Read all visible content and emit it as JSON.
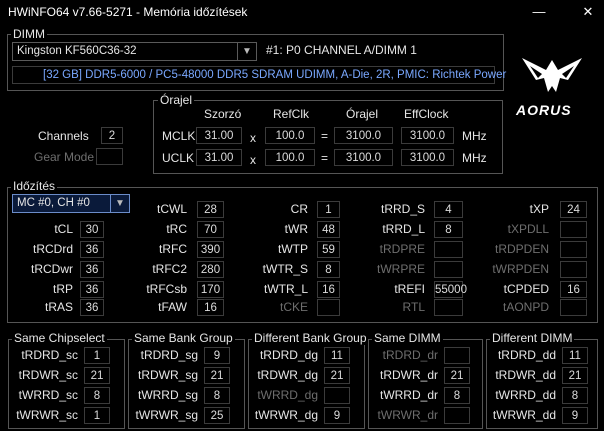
{
  "window": {
    "title": "HWiNFO64 v7.66-5271 - Memória időzítések",
    "minimize": "—",
    "close": "✕"
  },
  "dimm": {
    "group_label": "DIMM",
    "module": "Kingston KF560C36-32",
    "slot": "#1: P0 CHANNEL A/DIMM 1",
    "info": "[32 GB] DDR5-6000 / PC5-48000 DDR5 SDRAM UDIMM, A-Die, 2R, PMIC: Richtek Power"
  },
  "logo": {
    "text": "AORUS"
  },
  "channels": {
    "label": "Channels",
    "value": "2",
    "gear_label": "Gear Mode",
    "gear_value": ""
  },
  "clock": {
    "group_label": "Órajel",
    "headers": [
      "Szorzó",
      "RefClk",
      "Órajel",
      "EffClock"
    ],
    "rows": [
      {
        "label": "MCLK",
        "mult": "31.00",
        "x": "x",
        "ref": "100.0",
        "eq": "=",
        "clock": "3100.0",
        "eff": "3100.0",
        "unit": "MHz"
      },
      {
        "label": "UCLK",
        "mult": "31.00",
        "x": "x",
        "ref": "100.0",
        "eq": "=",
        "clock": "3100.0",
        "eff": "3100.0",
        "unit": "MHz"
      }
    ]
  },
  "timings": {
    "group_label": "Időzítés",
    "selector": "MC #0, CH #0",
    "col1": [
      {
        "label": "tCL",
        "value": "30"
      },
      {
        "label": "tRCDrd",
        "value": "36"
      },
      {
        "label": "tRCDwr",
        "value": "36"
      },
      {
        "label": "tRP",
        "value": "36"
      },
      {
        "label": "tRAS",
        "value": "36"
      }
    ],
    "col2": [
      {
        "label": "tCWL",
        "value": "28"
      },
      {
        "label": "tRC",
        "value": "70"
      },
      {
        "label": "tRFC",
        "value": "390"
      },
      {
        "label": "tRFC2",
        "value": "280"
      },
      {
        "label": "tRFCsb",
        "value": "170"
      },
      {
        "label": "tFAW",
        "value": "16"
      }
    ],
    "col3": [
      {
        "label": "CR",
        "value": "1"
      },
      {
        "label": "tWR",
        "value": "48"
      },
      {
        "label": "tWTP",
        "value": "59"
      },
      {
        "label": "tWTR_S",
        "value": "8"
      },
      {
        "label": "tWTR_L",
        "value": "16"
      },
      {
        "label": "tCKE",
        "value": ""
      }
    ],
    "col4": [
      {
        "label": "tRRD_S",
        "value": "4"
      },
      {
        "label": "tRRD_L",
        "value": "8"
      },
      {
        "label": "tRDPRE",
        "value": ""
      },
      {
        "label": "tWRPRE",
        "value": ""
      },
      {
        "label": "tREFI",
        "value": "55000"
      },
      {
        "label": "RTL",
        "value": ""
      }
    ],
    "col5": [
      {
        "label": "tXP",
        "value": "24"
      },
      {
        "label": "tXPDLL",
        "value": ""
      },
      {
        "label": "tRDPDEN",
        "value": ""
      },
      {
        "label": "tWRPDEN",
        "value": ""
      },
      {
        "label": "tCPDED",
        "value": "16"
      },
      {
        "label": "tAONPD",
        "value": ""
      }
    ]
  },
  "groups": [
    {
      "title": "Same Chipselect",
      "rows": [
        {
          "label": "tRDRD_sc",
          "value": "1"
        },
        {
          "label": "tRDWR_sc",
          "value": "21"
        },
        {
          "label": "tWRRD_sc",
          "value": "8"
        },
        {
          "label": "tWRWR_sc",
          "value": "1"
        }
      ]
    },
    {
      "title": "Same Bank Group",
      "rows": [
        {
          "label": "tRDRD_sg",
          "value": "9"
        },
        {
          "label": "tRDWR_sg",
          "value": "21"
        },
        {
          "label": "tWRRD_sg",
          "value": "8"
        },
        {
          "label": "tWRWR_sg",
          "value": "25"
        }
      ]
    },
    {
      "title": "Different Bank Group",
      "rows": [
        {
          "label": "tRDRD_dg",
          "value": "11"
        },
        {
          "label": "tRDWR_dg",
          "value": "21"
        },
        {
          "label": "tWRRD_dg",
          "value": ""
        },
        {
          "label": "tWRWR_dg",
          "value": "9"
        }
      ]
    },
    {
      "title": "Same DIMM",
      "rows": [
        {
          "label": "tRDRD_dr",
          "value": ""
        },
        {
          "label": "tRDWR_dr",
          "value": "21"
        },
        {
          "label": "tWRRD_dr",
          "value": "8"
        },
        {
          "label": "tWRWR_dr",
          "value": ""
        }
      ]
    },
    {
      "title": "Different DIMM",
      "rows": [
        {
          "label": "tRDRD_dd",
          "value": "11"
        },
        {
          "label": "tRDWR_dd",
          "value": "21"
        },
        {
          "label": "tWRRD_dd",
          "value": "8"
        },
        {
          "label": "tWRWR_dd",
          "value": "9"
        }
      ]
    }
  ]
}
